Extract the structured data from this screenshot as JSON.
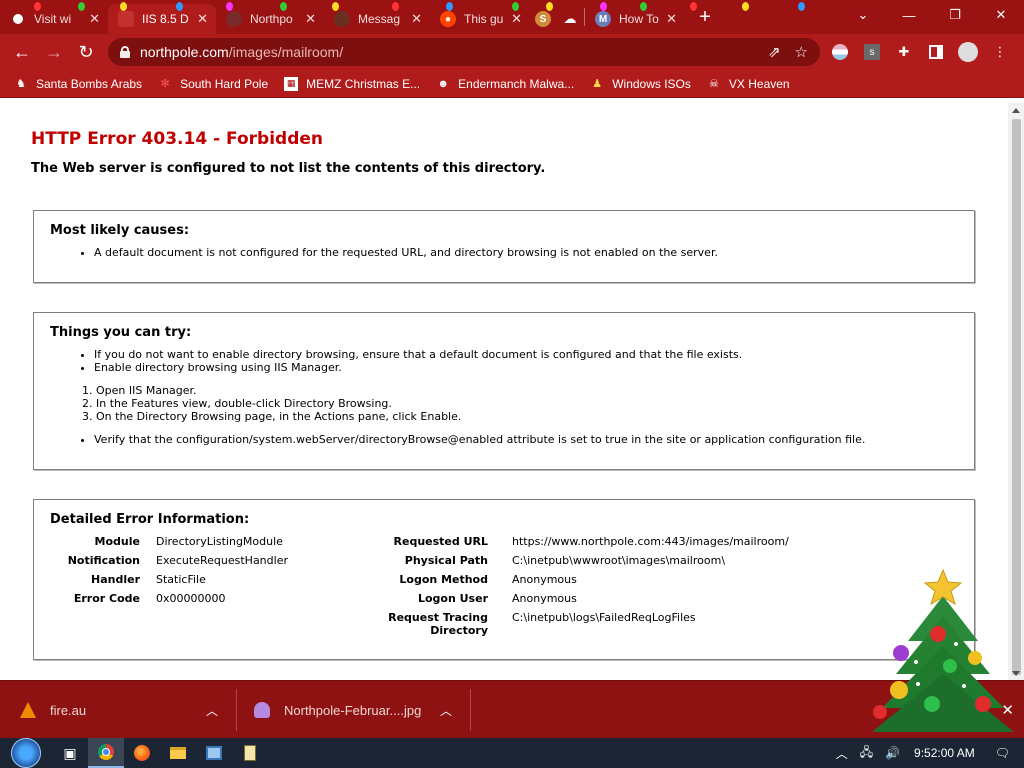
{
  "tabs": [
    {
      "label": "Visit wi",
      "favicon": "chrome-icon",
      "color": "#ffffff",
      "active": false
    },
    {
      "label": "IIS 8.5 D",
      "favicon": "iis-icon",
      "color": "#c23030",
      "active": true
    },
    {
      "label": "Northpo",
      "favicon": "northpole-icon",
      "color": "#8b3a3a",
      "active": false
    },
    {
      "label": "Messag",
      "favicon": "message-icon",
      "color": "#7a3a2a",
      "active": false
    },
    {
      "label": "This gu",
      "favicon": "reddit-icon",
      "color": "#ff4500",
      "active": false
    },
    {
      "label": "",
      "favicon": "s-icon",
      "color": "#d08a3a",
      "active": false
    },
    {
      "label": "",
      "favicon": "cloud-icon",
      "color": "#ffffff",
      "active": false
    },
    {
      "label": "How To",
      "favicon": "m-icon",
      "color": "#6c7dbb",
      "active": false
    }
  ],
  "window": {
    "minimize": "—",
    "restore": "❐",
    "close": "✕",
    "tab_menu": "⌄",
    "new_tab": "+"
  },
  "address": {
    "host": "northpole.com",
    "path": "/images/mailroom/"
  },
  "bookmarks": [
    {
      "label": "Santa Bombs Arabs",
      "icon": "santa-icon"
    },
    {
      "label": "South Hard Pole",
      "icon": "snowflake-icon"
    },
    {
      "label": "MEMZ Christmas E...",
      "icon": "memz-icon"
    },
    {
      "label": "Endermanch Malwa...",
      "icon": "endermanch-icon"
    },
    {
      "label": "Windows ISOs",
      "icon": "windows-isos-icon"
    },
    {
      "label": "VX Heaven",
      "icon": "vx-heaven-icon"
    }
  ],
  "error": {
    "title": "HTTP Error 403.14 - Forbidden",
    "subtitle": "The Web server is configured to not list the contents of this directory."
  },
  "causes": {
    "heading": "Most likely causes:",
    "items": [
      "A default document is not configured for the requested URL, and directory browsing is not enabled on the server."
    ]
  },
  "try": {
    "heading": "Things you can try:",
    "items": [
      "If you do not want to enable directory browsing, ensure that a default document is configured and that the file exists.",
      "Enable directory browsing using IIS Manager."
    ],
    "steps": [
      "Open IIS Manager.",
      "In the Features view, double-click Directory Browsing.",
      "On the Directory Browsing page, in the Actions pane, click Enable."
    ],
    "last": "Verify that the configuration/system.webServer/directoryBrowse@enabled attribute is set to true in the site or application configuration file."
  },
  "detail": {
    "heading": "Detailed Error Information:",
    "left": [
      {
        "label": "Module",
        "value": "DirectoryListingModule"
      },
      {
        "label": "Notification",
        "value": "ExecuteRequestHandler"
      },
      {
        "label": "Handler",
        "value": "StaticFile"
      },
      {
        "label": "Error Code",
        "value": "0x00000000"
      }
    ],
    "right": [
      {
        "label": "Requested URL",
        "value": "https://www.northpole.com:443/images/mailroom/"
      },
      {
        "label": "Physical Path",
        "value": "C:\\inetpub\\wwwroot\\images\\mailroom\\"
      },
      {
        "label": "Logon Method",
        "value": "Anonymous"
      },
      {
        "label": "Logon User",
        "value": "Anonymous"
      },
      {
        "label": "Request Tracing",
        "label2": "Directory",
        "value": "C:\\inetpub\\logs\\FailedReqLogFiles"
      }
    ]
  },
  "downloads": [
    {
      "name": "fire.au",
      "icon": "vlc-icon"
    },
    {
      "name": "Northpole-Februar....jpg",
      "icon": "image-file-icon"
    }
  ],
  "taskbar": {
    "time": "9:52:00 AM"
  }
}
